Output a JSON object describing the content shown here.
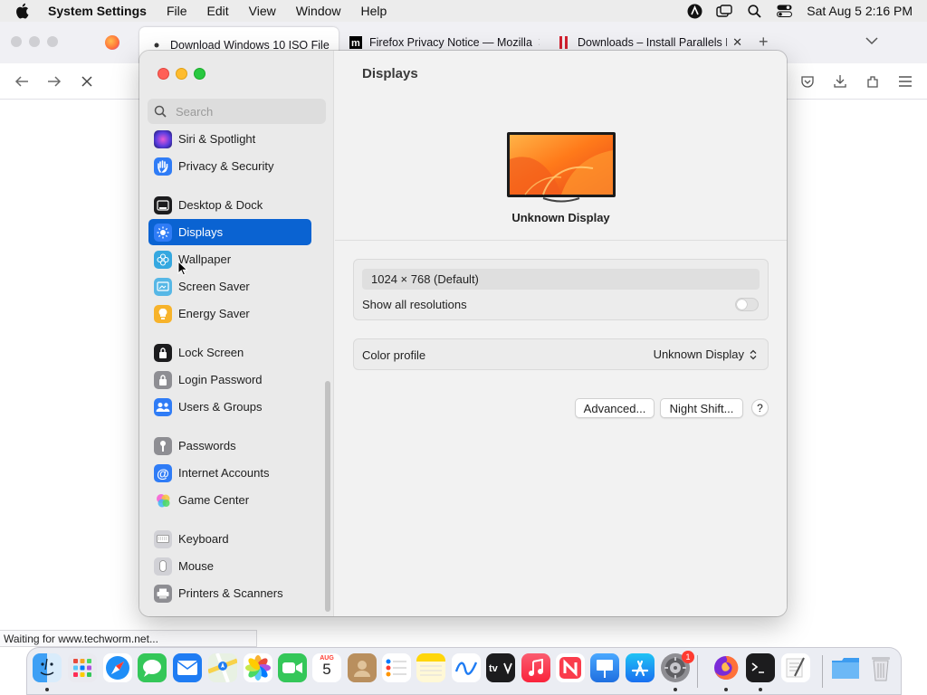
{
  "menubar": {
    "app_name": "System Settings",
    "items": [
      "File",
      "Edit",
      "View",
      "Window",
      "Help"
    ],
    "clock": "Sat Aug 5  2:16 PM"
  },
  "browser": {
    "tabs": [
      {
        "title": "Download Windows 10 ISO File",
        "active": true
      },
      {
        "title": "Firefox Privacy Notice — Mozilla",
        "active": false
      },
      {
        "title": "Downloads – Install Parallels De",
        "active": false
      }
    ],
    "status_text": "Waiting for www.techworm.net..."
  },
  "settings": {
    "search_placeholder": "Search",
    "sidebar_items": [
      {
        "label": "Siri & Spotlight",
        "icon": "siri-icon",
        "color": "#6a2fa8"
      },
      {
        "label": "Privacy & Security",
        "icon": "hand-icon",
        "color": "#2f7cf6"
      },
      {
        "label": "Desktop & Dock",
        "icon": "dock-icon",
        "color": "#1c1c1e"
      },
      {
        "label": "Displays",
        "icon": "sun-icon",
        "color": "#2f7cf6",
        "selected": true
      },
      {
        "label": "Wallpaper",
        "icon": "flower-icon",
        "color": "#35a8e0"
      },
      {
        "label": "Screen Saver",
        "icon": "screensaver-icon",
        "color": "#56b7e6"
      },
      {
        "label": "Energy Saver",
        "icon": "bulb-icon",
        "color": "#f7b32b"
      },
      {
        "label": "Lock Screen",
        "icon": "lock-icon",
        "color": "#1c1c1e"
      },
      {
        "label": "Login Password",
        "icon": "padlock-icon",
        "color": "#8e8e93"
      },
      {
        "label": "Users & Groups",
        "icon": "users-icon",
        "color": "#2f7cf6"
      },
      {
        "label": "Passwords",
        "icon": "key-icon",
        "color": "#8e8e93"
      },
      {
        "label": "Internet Accounts",
        "icon": "at-icon",
        "color": "#2f7cf6"
      },
      {
        "label": "Game Center",
        "icon": "game-center-icon",
        "color": "#ffffff"
      },
      {
        "label": "Keyboard",
        "icon": "keyboard-icon",
        "color": "#c7c7cc"
      },
      {
        "label": "Mouse",
        "icon": "mouse-icon",
        "color": "#c7c7cc"
      },
      {
        "label": "Printers & Scanners",
        "icon": "printer-icon",
        "color": "#8e8e93"
      }
    ],
    "pane_title": "Displays",
    "display_name": "Unknown Display",
    "resolution": "1024 × 768 (Default)",
    "show_all_resolutions_label": "Show all resolutions",
    "show_all_resolutions_on": false,
    "color_profile_label": "Color profile",
    "color_profile_value": "Unknown Display",
    "advanced_button": "Advanced...",
    "night_shift_button": "Night Shift...",
    "help_button": "?"
  },
  "dock": {
    "calendar_month": "AUG",
    "calendar_day": "5",
    "settings_badge": "1",
    "apps": [
      "finder",
      "launchpad",
      "safari",
      "messages",
      "mail",
      "maps",
      "photos",
      "facetime",
      "calendar",
      "contacts",
      "reminders",
      "notes",
      "freeform",
      "tv",
      "music",
      "news",
      "keynote",
      "app-store",
      "system-settings",
      "firefox",
      "terminal",
      "textedit",
      "downloads",
      "trash"
    ]
  },
  "colors": {
    "accent": "#0a63d2",
    "sidebar_bg": "#eaeaea",
    "content_bg": "#f2f2f2"
  }
}
